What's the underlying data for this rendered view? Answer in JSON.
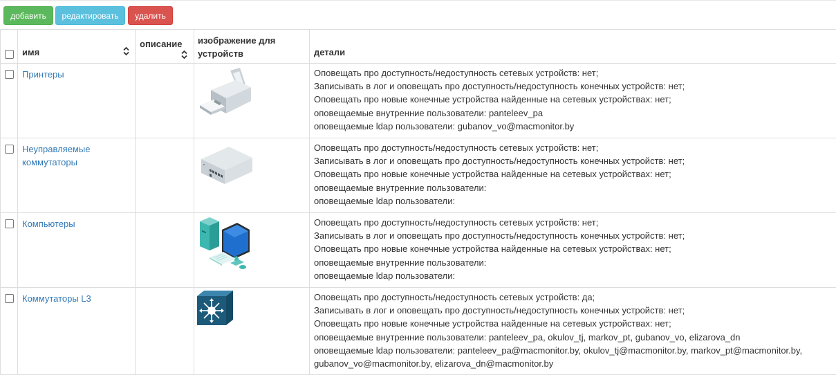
{
  "toolbar": {
    "add_label": "добавить",
    "edit_label": "редактировать",
    "delete_label": "удалить"
  },
  "table": {
    "headers": {
      "name": "имя",
      "description": "описание",
      "image_line1": "изображение для",
      "image_line2": "устройств",
      "details": "детали"
    },
    "rows": [
      {
        "name": "Принтеры",
        "description": "",
        "image_icon": "printer-icon",
        "details": [
          "Оповещать про доступность/недоступность сетевых устройств:  нет;",
          "Записывать в лог и оповещать про доступность/недоступность конечных устройств:  нет;",
          "Оповещать про новые конечные устройства найденные на сетевых устройствах:  нет;",
          "оповещаемые внутренние пользователи: panteleev_pa",
          "оповещаемые ldap пользователи: gubanov_vo@macmonitor.by"
        ]
      },
      {
        "name_line1": "Неуправляемые",
        "name_line2": "коммутаторы",
        "description": "",
        "image_icon": "switch-icon",
        "details": [
          "Оповещать про доступность/недоступность сетевых устройств:  нет;",
          "Записывать в лог и оповещать про доступность/недоступность конечных устройств:  нет;",
          "Оповещать про новые конечные устройства найденные на сетевых устройствах:  нет;",
          "оповещаемые внутренние пользователи:",
          "оповещаемые ldap пользователи:"
        ]
      },
      {
        "name": "Компьютеры",
        "description": "",
        "image_icon": "computer-icon",
        "details": [
          "Оповещать про доступность/недоступность сетевых устройств:  нет;",
          "Записывать в лог и оповещать про доступность/недоступность конечных устройств:  нет;",
          "Оповещать про новые конечные устройства найденные на сетевых устройствах:  нет;",
          "оповещаемые внутренние пользователи:",
          "оповещаемые ldap пользователи:"
        ]
      },
      {
        "name": "Коммутаторы L3",
        "description": "",
        "image_icon": "l3-switch-icon",
        "details": [
          "Оповещать про доступность/недоступность сетевых устройств:  да;",
          "Записывать в лог и оповещать про доступность/недоступность конечных устройств:  нет;",
          "Оповещать про новые конечные устройства найденные на сетевых устройствах:  нет;",
          "оповещаемые внутренние пользователи: panteleev_pa,  okulov_tj,  markov_pt,  gubanov_vo,  elizarova_dn",
          "оповещаемые ldap пользователи: panteleev_pa@macmonitor.by,   okulov_tj@macmonitor.by,   markov_pt@macmonitor.by,",
          "gubanov_vo@macmonitor.by,   elizarova_dn@macmonitor.by"
        ]
      }
    ]
  },
  "colors": {
    "add": "#5cb85c",
    "edit": "#5bc0de",
    "delete": "#d9534f",
    "link": "#337ab7",
    "l3_switch": "#1d5a7a"
  }
}
